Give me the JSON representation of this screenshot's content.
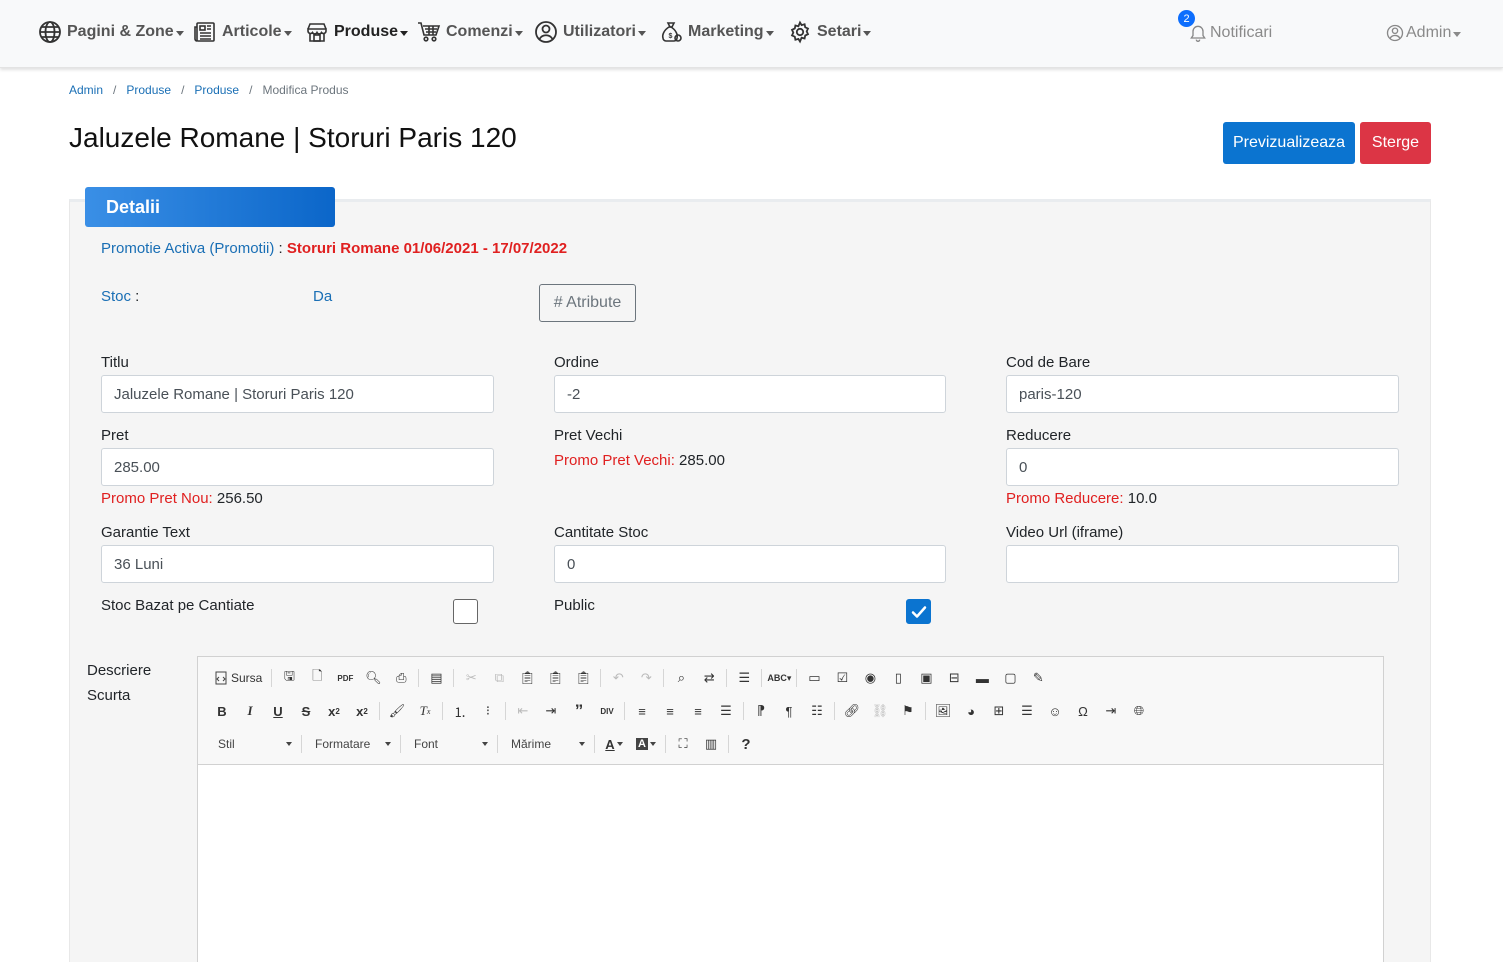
{
  "nav": {
    "items": [
      {
        "label": "Pagini & Zone",
        "icon": "globe-icon"
      },
      {
        "label": "Articole",
        "icon": "newspaper-icon"
      },
      {
        "label": "Produse",
        "icon": "store-icon"
      },
      {
        "label": "Comenzi",
        "icon": "cart-icon"
      },
      {
        "label": "Utilizatori",
        "icon": "user-circle-icon"
      },
      {
        "label": "Marketing",
        "icon": "money-bag-icon"
      },
      {
        "label": "Setari",
        "icon": "gear-icon"
      }
    ],
    "active": "Produse",
    "notifications_label": "Notificari",
    "notifications_count": "2",
    "user_label": "Admin"
  },
  "breadcrumb": [
    "Admin",
    "Produse",
    "Produse",
    "Modifica Produs"
  ],
  "page_title": "Jaluzele Romane | Storuri Paris 120",
  "actions": {
    "preview": "Previzualizeaza",
    "delete": "Sterge"
  },
  "panel": {
    "tab": "Detalii",
    "promo_prefix": "Promotie Activa (Promotii)",
    "promo_sep": " : ",
    "promo_name": "Storuri Romane 01/06/2021 - 17/07/2022",
    "stoc_label": "Stoc",
    "stoc_colon": " :",
    "stoc_value": "Da",
    "atribute_button": "# Atribute"
  },
  "fields": {
    "titlu": {
      "label": "Titlu",
      "value": "Jaluzele Romane | Storuri Paris 120"
    },
    "ordine": {
      "label": "Ordine",
      "value": "-2"
    },
    "cod_bare": {
      "label": "Cod de Bare",
      "value": "paris-120"
    },
    "pret": {
      "label": "Pret",
      "value": "285.00",
      "promo_label": "Promo Pret Nou:",
      "promo_value": " 256.50"
    },
    "pret_vechi": {
      "label": "Pret Vechi",
      "promo_label": "Promo Pret Vechi:",
      "promo_value": " 285.00"
    },
    "reducere": {
      "label": "Reducere",
      "value": "0",
      "promo_label": "Promo Reducere:",
      "promo_value": " 10.0"
    },
    "garantie": {
      "label": "Garantie Text",
      "value": "36 Luni"
    },
    "cantitate": {
      "label": "Cantitate Stoc",
      "value": "0"
    },
    "video": {
      "label": "Video Url (iframe)",
      "value": ""
    },
    "stoc_bazat": {
      "label": "Stoc Bazat pe Cantiate",
      "checked": false
    },
    "public": {
      "label": "Public",
      "checked": true
    }
  },
  "editor": {
    "label_line1": "Descriere",
    "label_line2": "Scurta",
    "source_label": "Sursa",
    "combos": [
      "Stil",
      "Formatare",
      "Font",
      "Mărime"
    ]
  },
  "colors": {
    "primary": "#0b74d0",
    "danger": "#dc3545",
    "link": "#1a6fb5",
    "promo_red": "#e02020"
  }
}
